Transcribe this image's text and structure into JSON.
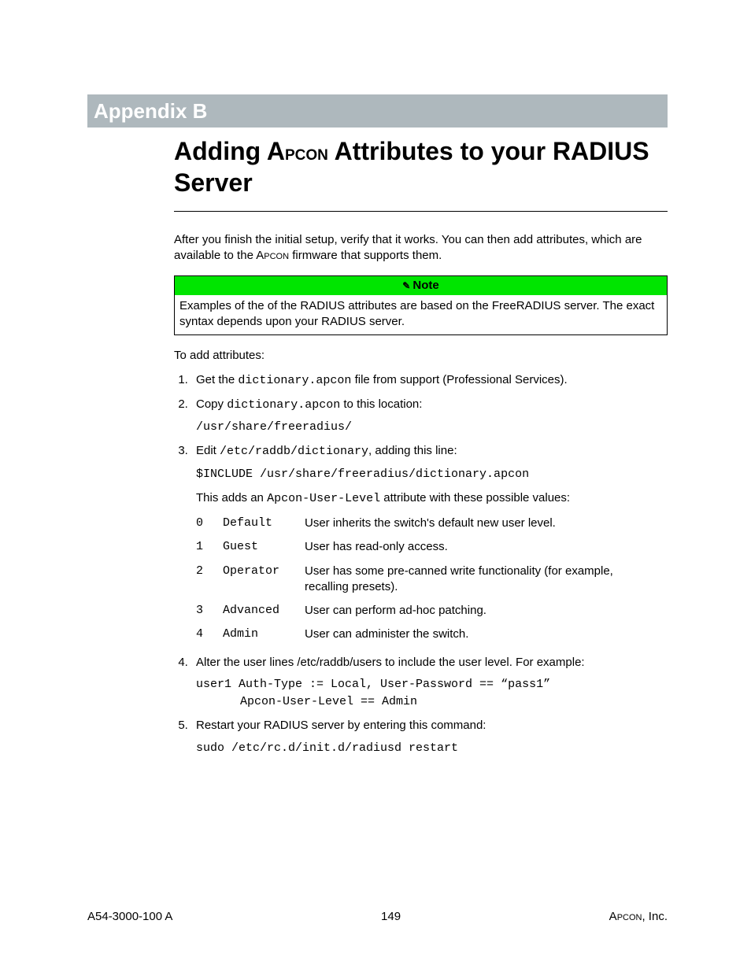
{
  "appendix_label": "Appendix B",
  "title_line1_pre": "Adding A",
  "title_line1_sc": "pcon",
  "title_line1_post": " Attributes to your RADIUS Server",
  "intro_pre": "After you finish the initial setup, verify that it works. You can then add attributes, which are available to the A",
  "intro_sc": "pcon",
  "intro_post": " firmware that supports them.",
  "note_label": "Note",
  "note_body": "Examples of the of the RADIUS attributes are based on the FreeRADIUS server. The exact syntax depends upon your RADIUS server.",
  "lead_in": "To add attributes:",
  "step1_a": "Get the ",
  "step1_code": "dictionary.apcon",
  "step1_b": " file from support (Professional Services).",
  "step2_a": "Copy ",
  "step2_code": "dictionary.apcon",
  "step2_b": " to this location:",
  "step2_path": "/usr/share/freeradius/",
  "step3_a": "Edit ",
  "step3_code": "/etc/raddb/dictionary",
  "step3_b": ", adding this line:",
  "step3_line": "$INCLUDE /usr/share/freeradius/dictionary.apcon",
  "step3_explain_a": "This adds an ",
  "step3_explain_code": "Apcon-User-Level",
  "step3_explain_b": " attribute with these possible values:",
  "values": [
    {
      "idx": "0",
      "name": "Default",
      "desc": "User inherits the switch's default new user level."
    },
    {
      "idx": "1",
      "name": "Guest",
      "desc": "User has read-only access."
    },
    {
      "idx": "2",
      "name": "Operator",
      "desc": "User has some pre-canned write functionality (for example, recalling presets)."
    },
    {
      "idx": "3",
      "name": "Advanced",
      "desc": "User can perform ad-hoc patching."
    },
    {
      "idx": "4",
      "name": "Admin",
      "desc": "User can administer the switch."
    }
  ],
  "step4": "Alter the user lines /etc/raddb/users to include the user level. For example:",
  "step4_code1": "user1  Auth-Type := Local, User-Password == “pass1”",
  "step4_code2": "Apcon-User-Level == Admin",
  "step5": "Restart your RADIUS server by entering this command:",
  "step5_code": "sudo /etc/rc.d/init.d/radiusd restart",
  "footer_left": "A54-3000-100 A",
  "footer_center": "149",
  "footer_right_pre": "A",
  "footer_right_sc": "pcon",
  "footer_right_post": ", Inc."
}
